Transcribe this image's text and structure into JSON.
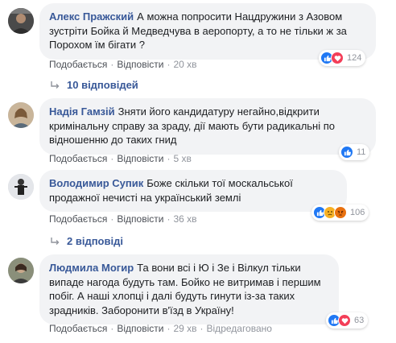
{
  "comments": [
    {
      "author": "Алекс Пражский",
      "text": "А можна попросити Нацдружини з Азовом зустріти Бойка й Медведчува в аеропорту, а то не тільки ж за Порохом їм бігати ?",
      "like_label": "Подобається",
      "reply_label": "Відповісти",
      "time": "20 хв",
      "reaction_count": "124",
      "reaction_icons": [
        "like-icon",
        "love-icon"
      ]
    },
    {
      "author": "Надія Гамзій",
      "text": "Зняти його кандидатуру негайно,відкрити кримінальну справу за зраду, дії мають бути радикальні по відношенню до таких гнид",
      "like_label": "Подобається",
      "reply_label": "Відповісти",
      "time": "5 хв",
      "reaction_count": "11",
      "reaction_icons": [
        "like-icon"
      ]
    },
    {
      "author": "Володимир Супик",
      "text": "Боже скільки тої москальської продажної нечисті на український землі",
      "like_label": "Подобається",
      "reply_label": "Відповісти",
      "time": "36 хв",
      "reaction_count": "106",
      "reaction_icons": [
        "like-icon",
        "sad-icon",
        "angry-icon"
      ]
    },
    {
      "author": "Людмила Могир",
      "text": "Та вони всі і Ю і Зе і Вілкул тільки випаде нагода будуть там. Бойко не витримав і першим побіг. А наші хлопці і далі будуть гинути із-за таких зрадників. Заборонити в'їзд в Україну!",
      "like_label": "Подобається",
      "reply_label": "Відповісти",
      "time": "29 хв",
      "edited_label": "Відредаговано",
      "reaction_count": "63",
      "reaction_icons": [
        "like-icon",
        "love-icon"
      ]
    }
  ],
  "replies_1": "10 відповідей",
  "replies_3": "2 відповіді",
  "colors": {
    "link": "#385898",
    "bubble": "#f2f3f5",
    "like": "#2078f4",
    "love": "#f33e58",
    "sad": "#f7b125",
    "angry": "#e9710f"
  }
}
